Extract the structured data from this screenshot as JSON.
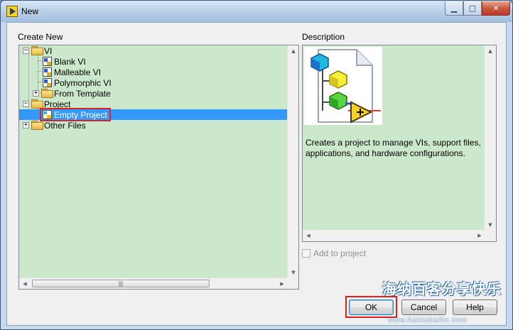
{
  "window": {
    "title": "New",
    "controls": {
      "minimize": "▁",
      "maximize": "□",
      "close": "✕"
    }
  },
  "create_new": {
    "label": "Create New",
    "tree": [
      {
        "label": "VI",
        "type": "folder",
        "expanded": true,
        "level": 0
      },
      {
        "label": "Blank VI",
        "type": "vi",
        "level": 1
      },
      {
        "label": "Malleable VI",
        "type": "vi",
        "level": 1
      },
      {
        "label": "Polymorphic VI",
        "type": "vi",
        "level": 1
      },
      {
        "label": "From Template",
        "type": "folder",
        "expanded": false,
        "level": 1
      },
      {
        "label": "Project",
        "type": "folder",
        "expanded": true,
        "level": 0
      },
      {
        "label": "Empty Project",
        "type": "project",
        "level": 1,
        "selected": true
      },
      {
        "label": "Other Files",
        "type": "folder",
        "expanded": false,
        "level": 0
      }
    ],
    "expander_minus": "−",
    "expander_plus": "+",
    "scroll_up": "▲",
    "scroll_down": "▼",
    "scroll_left": "◀",
    "scroll_right": "▶",
    "hthumb_grip": "|||"
  },
  "description": {
    "label": "Description",
    "text": "Creates a project to manage VIs, support files, applications, and hardware configurations."
  },
  "add_to_project": {
    "label": "Add to project",
    "checked": false,
    "enabled": false
  },
  "buttons": {
    "ok": "OK",
    "cancel": "Cancel",
    "help": "Help"
  },
  "watermark": {
    "main": "海纳百客分享快乐",
    "sub": "www.hainabaike.com"
  },
  "colors": {
    "selection": "#3399ff",
    "highlight_box": "#e02020",
    "panel_bg": "#cce8cc"
  }
}
